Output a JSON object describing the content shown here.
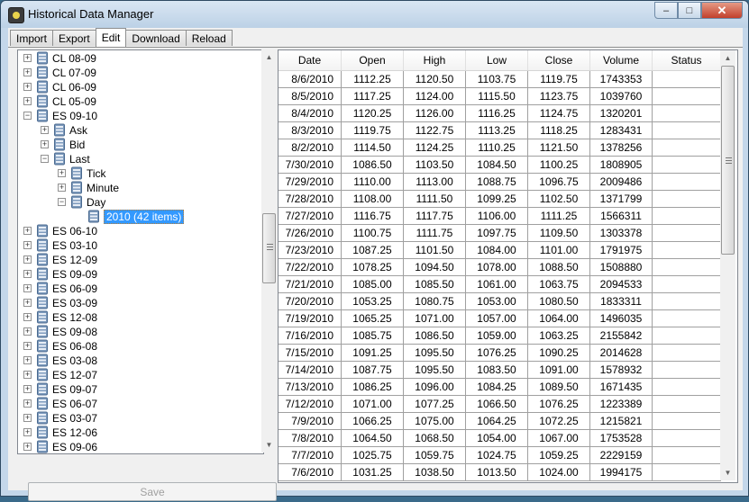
{
  "window": {
    "title": "Historical Data Manager",
    "min": "–",
    "max": "□",
    "close": "✕"
  },
  "tabs": [
    "Import",
    "Export",
    "Edit",
    "Download",
    "Reload"
  ],
  "active_tab": "Edit",
  "tree": [
    {
      "label": "CL 08-09",
      "level": 0,
      "expander": "+"
    },
    {
      "label": "CL 07-09",
      "level": 0,
      "expander": "+"
    },
    {
      "label": "CL 06-09",
      "level": 0,
      "expander": "+"
    },
    {
      "label": "CL 05-09",
      "level": 0,
      "expander": "+"
    },
    {
      "label": "ES 09-10",
      "level": 0,
      "expander": "−"
    },
    {
      "label": "Ask",
      "level": 1,
      "expander": "+"
    },
    {
      "label": "Bid",
      "level": 1,
      "expander": "+"
    },
    {
      "label": "Last",
      "level": 1,
      "expander": "−"
    },
    {
      "label": "Tick",
      "level": 2,
      "expander": "+"
    },
    {
      "label": "Minute",
      "level": 2,
      "expander": "+"
    },
    {
      "label": "Day",
      "level": 2,
      "expander": "−"
    },
    {
      "label": "2010 (42 items)",
      "level": 3,
      "expander": "",
      "selected": true
    },
    {
      "label": "ES 06-10",
      "level": 0,
      "expander": "+"
    },
    {
      "label": "ES 03-10",
      "level": 0,
      "expander": "+"
    },
    {
      "label": "ES 12-09",
      "level": 0,
      "expander": "+"
    },
    {
      "label": "ES 09-09",
      "level": 0,
      "expander": "+"
    },
    {
      "label": "ES 06-09",
      "level": 0,
      "expander": "+"
    },
    {
      "label": "ES 03-09",
      "level": 0,
      "expander": "+"
    },
    {
      "label": "ES 12-08",
      "level": 0,
      "expander": "+"
    },
    {
      "label": "ES 09-08",
      "level": 0,
      "expander": "+"
    },
    {
      "label": "ES 06-08",
      "level": 0,
      "expander": "+"
    },
    {
      "label": "ES 03-08",
      "level": 0,
      "expander": "+"
    },
    {
      "label": "ES 12-07",
      "level": 0,
      "expander": "+"
    },
    {
      "label": "ES 09-07",
      "level": 0,
      "expander": "+"
    },
    {
      "label": "ES 06-07",
      "level": 0,
      "expander": "+"
    },
    {
      "label": "ES 03-07",
      "level": 0,
      "expander": "+"
    },
    {
      "label": "ES 12-06",
      "level": 0,
      "expander": "+"
    },
    {
      "label": "ES 09-06",
      "level": 0,
      "expander": "+"
    }
  ],
  "save_button": "Save",
  "grid": {
    "columns": [
      "Date",
      "Open",
      "High",
      "Low",
      "Close",
      "Volume",
      "Status"
    ],
    "rows": [
      [
        "8/6/2010",
        "1112.25",
        "1120.50",
        "1103.75",
        "1119.75",
        "1743353",
        ""
      ],
      [
        "8/5/2010",
        "1117.25",
        "1124.00",
        "1115.50",
        "1123.75",
        "1039760",
        ""
      ],
      [
        "8/4/2010",
        "1120.25",
        "1126.00",
        "1116.25",
        "1124.75",
        "1320201",
        ""
      ],
      [
        "8/3/2010",
        "1119.75",
        "1122.75",
        "1113.25",
        "1118.25",
        "1283431",
        ""
      ],
      [
        "8/2/2010",
        "1114.50",
        "1124.25",
        "1110.25",
        "1121.50",
        "1378256",
        ""
      ],
      [
        "7/30/2010",
        "1086.50",
        "1103.50",
        "1084.50",
        "1100.25",
        "1808905",
        ""
      ],
      [
        "7/29/2010",
        "1110.00",
        "1113.00",
        "1088.75",
        "1096.75",
        "2009486",
        ""
      ],
      [
        "7/28/2010",
        "1108.00",
        "1111.50",
        "1099.25",
        "1102.50",
        "1371799",
        ""
      ],
      [
        "7/27/2010",
        "1116.75",
        "1117.75",
        "1106.00",
        "1111.25",
        "1566311",
        ""
      ],
      [
        "7/26/2010",
        "1100.75",
        "1111.75",
        "1097.75",
        "1109.50",
        "1303378",
        ""
      ],
      [
        "7/23/2010",
        "1087.25",
        "1101.50",
        "1084.00",
        "1101.00",
        "1791975",
        ""
      ],
      [
        "7/22/2010",
        "1078.25",
        "1094.50",
        "1078.00",
        "1088.50",
        "1508880",
        ""
      ],
      [
        "7/21/2010",
        "1085.00",
        "1085.50",
        "1061.00",
        "1063.75",
        "2094533",
        ""
      ],
      [
        "7/20/2010",
        "1053.25",
        "1080.75",
        "1053.00",
        "1080.50",
        "1833311",
        ""
      ],
      [
        "7/19/2010",
        "1065.25",
        "1071.00",
        "1057.00",
        "1064.00",
        "1496035",
        ""
      ],
      [
        "7/16/2010",
        "1085.75",
        "1086.50",
        "1059.00",
        "1063.25",
        "2155842",
        ""
      ],
      [
        "7/15/2010",
        "1091.25",
        "1095.50",
        "1076.25",
        "1090.25",
        "2014628",
        ""
      ],
      [
        "7/14/2010",
        "1087.75",
        "1095.50",
        "1083.50",
        "1091.00",
        "1578932",
        ""
      ],
      [
        "7/13/2010",
        "1086.25",
        "1096.00",
        "1084.25",
        "1089.50",
        "1671435",
        ""
      ],
      [
        "7/12/2010",
        "1071.00",
        "1077.25",
        "1066.50",
        "1076.25",
        "1223389",
        ""
      ],
      [
        "7/9/2010",
        "1066.25",
        "1075.00",
        "1064.25",
        "1072.25",
        "1215821",
        ""
      ],
      [
        "7/8/2010",
        "1064.50",
        "1068.50",
        "1054.00",
        "1067.00",
        "1753528",
        ""
      ],
      [
        "7/7/2010",
        "1025.75",
        "1059.75",
        "1024.75",
        "1059.25",
        "2229159",
        ""
      ],
      [
        "7/6/2010",
        "1031.25",
        "1038.50",
        "1013.50",
        "1024.00",
        "1994175",
        ""
      ]
    ]
  },
  "colors": {
    "selection": "#3399ff",
    "title_bar": "#c4d7ea",
    "close_button": "#c2402b"
  },
  "icons": {
    "tree_node": "database-icon",
    "scroll_up": "scroll-up-icon",
    "scroll_down": "scroll-down-icon"
  }
}
